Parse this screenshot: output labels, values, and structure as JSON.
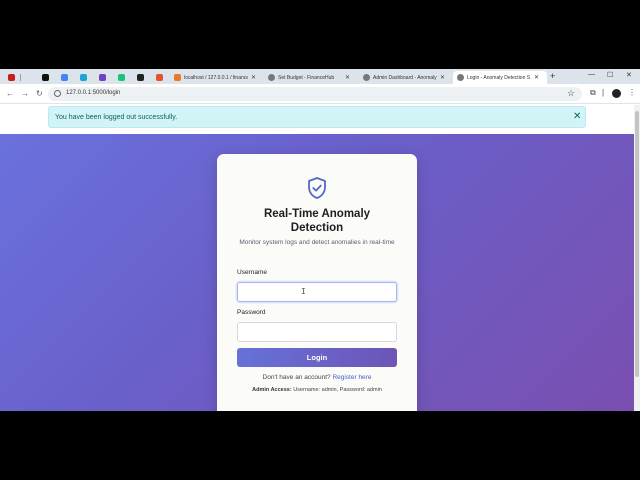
{
  "browser": {
    "tabs": [
      {
        "title": "",
        "pinned": true,
        "favicon_color": "#c81e1e"
      },
      {
        "title": "",
        "pinned": true,
        "favicon_color": "#111111"
      },
      {
        "title": "",
        "pinned": true,
        "favicon_color": "#4285f4"
      },
      {
        "title": "",
        "pinned": true,
        "favicon_color": "#1fa3d6"
      },
      {
        "title": "",
        "pinned": true,
        "favicon_color": "#19c37d"
      },
      {
        "title": "",
        "pinned": true,
        "favicon_color": "#222222"
      },
      {
        "title": "",
        "pinned": true,
        "favicon_color": "#6f42c1"
      },
      {
        "title": "",
        "pinned": true,
        "favicon_color": "#e8502f"
      },
      {
        "title": "localhost / 127.0.0.1 / finance",
        "pinned": false,
        "favicon_color": "#e77a2b"
      },
      {
        "title": "Set Budget - FinanceHub",
        "pinned": false,
        "favicon_color": "#777777"
      },
      {
        "title": "Admin Dashboard - Anomaly",
        "pinned": false,
        "favicon_color": "#777777"
      },
      {
        "title": "Login - Anomaly Detection S",
        "pinned": false,
        "favicon_color": "#777777",
        "active": true
      }
    ],
    "new_tab": "+",
    "url": "127.0.0.1:5000/login"
  },
  "alert": {
    "message": "You have been logged out successfully.",
    "close": "✕"
  },
  "login": {
    "title_line1": "Real-Time Anomaly",
    "title_line2": "Detection",
    "subtitle": "Monitor system logs and detect anomalies in real-time",
    "username_label": "Username",
    "username_value": "",
    "password_label": "Password",
    "password_value": "",
    "button": "Login",
    "register_prompt": "Don't have an account?",
    "register_link": "Register here",
    "admin_label": "Admin Access:",
    "admin_text": "Username: admin, Password: admin"
  },
  "colors": {
    "accent": "#6572d8",
    "gradient_start": "#6a72de",
    "gradient_end": "#7a4fb0",
    "alert_bg": "#d2f4f7"
  },
  "icons": {
    "brand": "shield-check-icon"
  }
}
